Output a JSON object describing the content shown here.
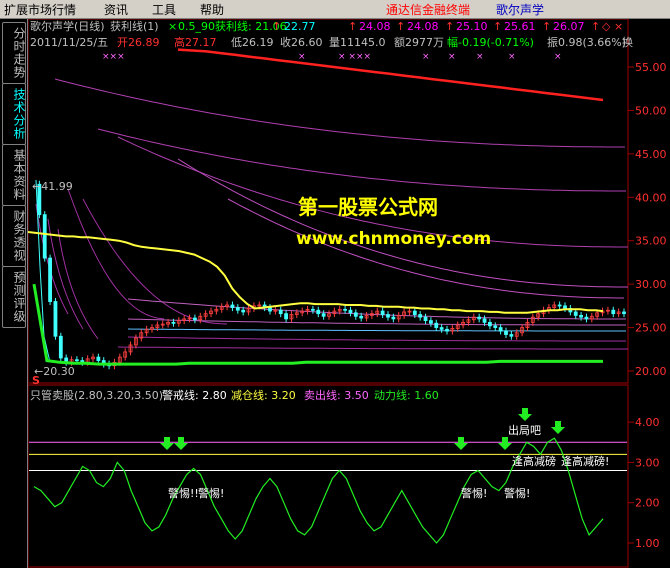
{
  "menubar": {
    "items": [
      "扩展市场行情",
      "资讯",
      "工具",
      "帮助"
    ],
    "app_title": "通达信金融终端",
    "doc_title": "歌尔声学"
  },
  "side_tabs": [
    "分时走势",
    "技术分析",
    "基本资料",
    "财务透视",
    "预测评级"
  ],
  "top_panel": {
    "indicator_header": {
      "name": "歌尔声学(日线)",
      "indicator": "获利线(1)",
      "param": "0.5_90获利线: 21.06",
      "v2": "22.77",
      "v3": "24.08",
      "v4": "24.08",
      "v5": "25.10",
      "v6": "25.61",
      "v7": "26.07"
    },
    "bar_info": {
      "date": "2011/11/25/五",
      "open": "开26.89",
      "high": "高27.17",
      "low": "低26.19",
      "close": "收26.60",
      "volume": "量11145.0",
      "amount": "额2977万",
      "change": "幅-0.19(-0.71%)",
      "amplitude": "振0.98(3.66%)",
      "turnover": "换"
    },
    "labels": {
      "high_mark": "41.99",
      "low_mark": "20.30",
      "s_mark": "S"
    },
    "y_ticks": [
      "55.00",
      "50.00",
      "45.00",
      "40.00",
      "35.00",
      "30.00",
      "25.00",
      "20.00"
    ]
  },
  "bottom_panel": {
    "header": {
      "name": "只管卖股(2.80,3.20,3.50)",
      "warn": "警戒线: 2.80",
      "reduce": "减仓线: 3.20",
      "sell": "卖出线: 3.50",
      "power": "动力线: 1.60"
    },
    "annotations": {
      "a1": "警惕!!",
      "a2": "警惕!",
      "a3": "警惕!",
      "a4": "出局吧",
      "a5": "逢高减磅",
      "a6": "逢高减磅!"
    },
    "y_ticks": [
      "4.00",
      "3.00",
      "2.00",
      "1.00"
    ]
  },
  "watermark": {
    "line1": "第一股票公式网",
    "line2": "www.chnmoney.com"
  },
  "chart_data": {
    "type": "line",
    "title": "",
    "top": {
      "ylim": [
        18.5,
        58
      ],
      "close": [
        41.5,
        38,
        33,
        28,
        24,
        21.5,
        21,
        21.3,
        21.2,
        21,
        21.4,
        21.6,
        21.2,
        20.8,
        20.6,
        21.0,
        21.6,
        22.2,
        23.0,
        23.8,
        24.4,
        24.8,
        25.0,
        25.3,
        25.4,
        25.6,
        25.5,
        25.8,
        26.0,
        26.1,
        25.9,
        26.3,
        26.6,
        26.9,
        27.1,
        27.4,
        27.6,
        27.3,
        27.0,
        26.8,
        27.2,
        27.5,
        27.6,
        27.3,
        26.9,
        27.0,
        26.6,
        26.0,
        26.5,
        26.7,
        26.9,
        27.1,
        27.0,
        26.6,
        26.3,
        26.6,
        26.9,
        27.1,
        27.0,
        26.7,
        26.3,
        26.1,
        26.4,
        26.6,
        26.9,
        26.5,
        26.2,
        26.0,
        26.4,
        26.8,
        26.9,
        26.5,
        26.2,
        25.8,
        25.5,
        25.0,
        24.8,
        24.6,
        24.9,
        25.3,
        25.6,
        25.9,
        26.2,
        26.0,
        25.6,
        25.2,
        25.0,
        24.6,
        24.2,
        24.0,
        24.4,
        25.0,
        25.6,
        26.2,
        26.6,
        27.0,
        27.3,
        27.6,
        27.5,
        27.2,
        26.8,
        26.4,
        26.2,
        26.0,
        26.3,
        26.7,
        26.9,
        27.0,
        26.6,
        26.8,
        26.6
      ],
      "yellow": [
        36,
        35.9,
        35.8,
        35.7,
        35.6,
        35.5,
        35.5,
        35.4,
        35.4,
        35.3,
        35.2,
        35.1,
        35.0,
        34.8,
        34.5,
        34.3,
        34.2,
        34.1,
        34.0,
        33.9,
        33.8,
        33.6,
        33.4,
        33.0,
        32.6,
        32.0,
        31.0,
        29.5,
        28.5,
        27.7,
        27.2,
        27.3,
        27.4,
        27.5,
        27.6,
        27.7,
        27.8,
        27.8,
        27.7,
        27.7,
        27.7,
        27.7,
        27.6,
        27.6,
        27.6,
        27.5,
        27.5,
        27.4,
        27.4,
        27.4,
        27.3,
        27.3,
        27.2,
        27.2,
        27.1,
        27.1,
        27.0,
        27.0,
        26.9,
        26.9,
        26.9,
        26.8,
        26.8,
        26.7,
        26.7,
        26.7,
        26.7,
        26.8,
        26.9,
        27.0,
        27.0,
        27.1,
        27.1,
        27.1,
        27.0,
        27.0,
        26.9
      ],
      "green": [
        30,
        21.2,
        21.0,
        20.9,
        20.9,
        20.8,
        20.8,
        20.8,
        20.8,
        20.8,
        20.8,
        20.8,
        20.9,
        20.9,
        20.9,
        20.9,
        20.9,
        20.9,
        20.9,
        20.9,
        20.9,
        21.0,
        21.0,
        21.0,
        21.0,
        21.0,
        21.0,
        21.0,
        21.0,
        21.0,
        21.0,
        21.0,
        21.0,
        21.0,
        21.0,
        21.0,
        21.1,
        21.1,
        21.1,
        21.1,
        21.1,
        21.1,
        21.1,
        21.1,
        21.1
      ],
      "red": [
        57.0,
        56.9,
        56.8,
        56.6,
        56.4,
        56.2,
        56.0,
        55.8,
        55.6,
        55.4,
        55.2,
        55.0,
        54.8,
        54.6,
        54.4,
        54.2,
        54.0,
        53.8,
        53.6,
        53.4,
        53.2,
        53.0,
        52.8,
        52.6,
        52.4,
        52.2,
        52.0,
        51.8,
        51.6,
        51.4,
        51.2
      ]
    },
    "bottom": {
      "ylim": [
        0.8,
        4.4
      ],
      "lines": [
        3.5,
        3.2,
        2.8
      ],
      "oscillator": [
        2.4,
        2.3,
        2.1,
        1.9,
        2.0,
        2.3,
        2.6,
        2.9,
        2.8,
        2.5,
        2.4,
        2.6,
        3.0,
        2.8,
        2.3,
        1.9,
        1.5,
        1.3,
        1.4,
        1.7,
        2.1,
        2.4,
        2.7,
        2.85,
        2.7,
        2.3,
        1.9,
        1.6,
        1.3,
        1.1,
        1.3,
        1.7,
        2.1,
        2.4,
        2.6,
        2.4,
        2.0,
        1.6,
        1.3,
        1.2,
        1.4,
        1.8,
        2.2,
        2.6,
        2.8,
        2.6,
        2.2,
        1.8,
        1.5,
        1.3,
        1.4,
        1.7,
        2.0,
        2.3,
        2.0,
        1.7,
        1.4,
        1.2,
        1.0,
        1.2,
        1.6,
        2.0,
        2.4,
        2.7,
        2.8,
        2.6,
        2.4,
        2.3,
        2.5,
        2.9,
        3.2,
        3.5,
        3.4,
        3.2,
        3.5,
        3.6,
        3.3,
        2.8,
        2.2,
        1.6,
        1.2,
        1.4,
        1.6
      ]
    }
  }
}
